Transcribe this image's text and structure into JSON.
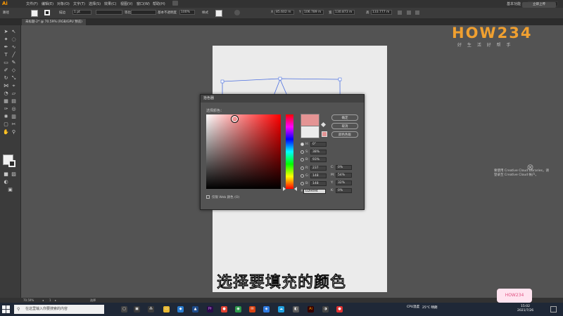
{
  "app": {
    "logo": "Ai",
    "workspace": "基本功能",
    "search_placeholder": "Adobe Stock"
  },
  "menu": [
    "文件(F)",
    "编辑(E)",
    "对象(O)",
    "文字(T)",
    "选择(S)",
    "效果(C)",
    "视图(V)",
    "窗口(W)",
    "帮助(H)"
  ],
  "sync_label": "立即上传",
  "control": {
    "path_label": "路径",
    "stroke_label": "描边",
    "stroke_weight": "1 pt",
    "profile_label": "等比",
    "brush_label": "基本",
    "opacity_label": "不透明度",
    "opacity_value": "100%",
    "style_label": "样式",
    "x_label": "X",
    "x_value": "85.602 m",
    "y_label": "Y",
    "y_value": "106.789 m",
    "w_label": "宽",
    "w_value": "130.873 m",
    "h_label": "高",
    "h_value": "133.777 m"
  },
  "document_tab": "未标题-2* @ 70.59% (RGB/GPU 预览)",
  "watermark": {
    "logo": "HOW234",
    "subtitle": "好 生 活 好 帮 手"
  },
  "cc_libraries": {
    "line1": "要使用 Creative Cloud Libraries，请",
    "line2": "登录至 Creative Cloud 帐户。"
  },
  "color_picker": {
    "title": "拾色器",
    "select_label": "选择颜色：",
    "ok": "确定",
    "cancel": "取消",
    "swatches": "颜色色板",
    "web_only": "仅限 Web 颜色 (O)",
    "new_color": "#e49494",
    "old_color": "#ebebeb",
    "fields": {
      "H": "0°",
      "S": "38%",
      "B": "93%",
      "R": "237",
      "G": "148",
      "Bv": "148",
      "C": "0%",
      "M": "54%",
      "Y": "32%",
      "K": "0%",
      "hex_label": "#",
      "hex": "ED9494"
    }
  },
  "status_bar": {
    "zoom": "70.59%",
    "page": "1",
    "mode": "选择"
  },
  "subtitle": "选择要填充的颜色",
  "taskbar": {
    "search_placeholder": "在这里输入你要搜索的内容",
    "weather": "25°C 晴朗",
    "cpu": "CPU温度",
    "time": "15:02",
    "date": "2021/7/26"
  }
}
